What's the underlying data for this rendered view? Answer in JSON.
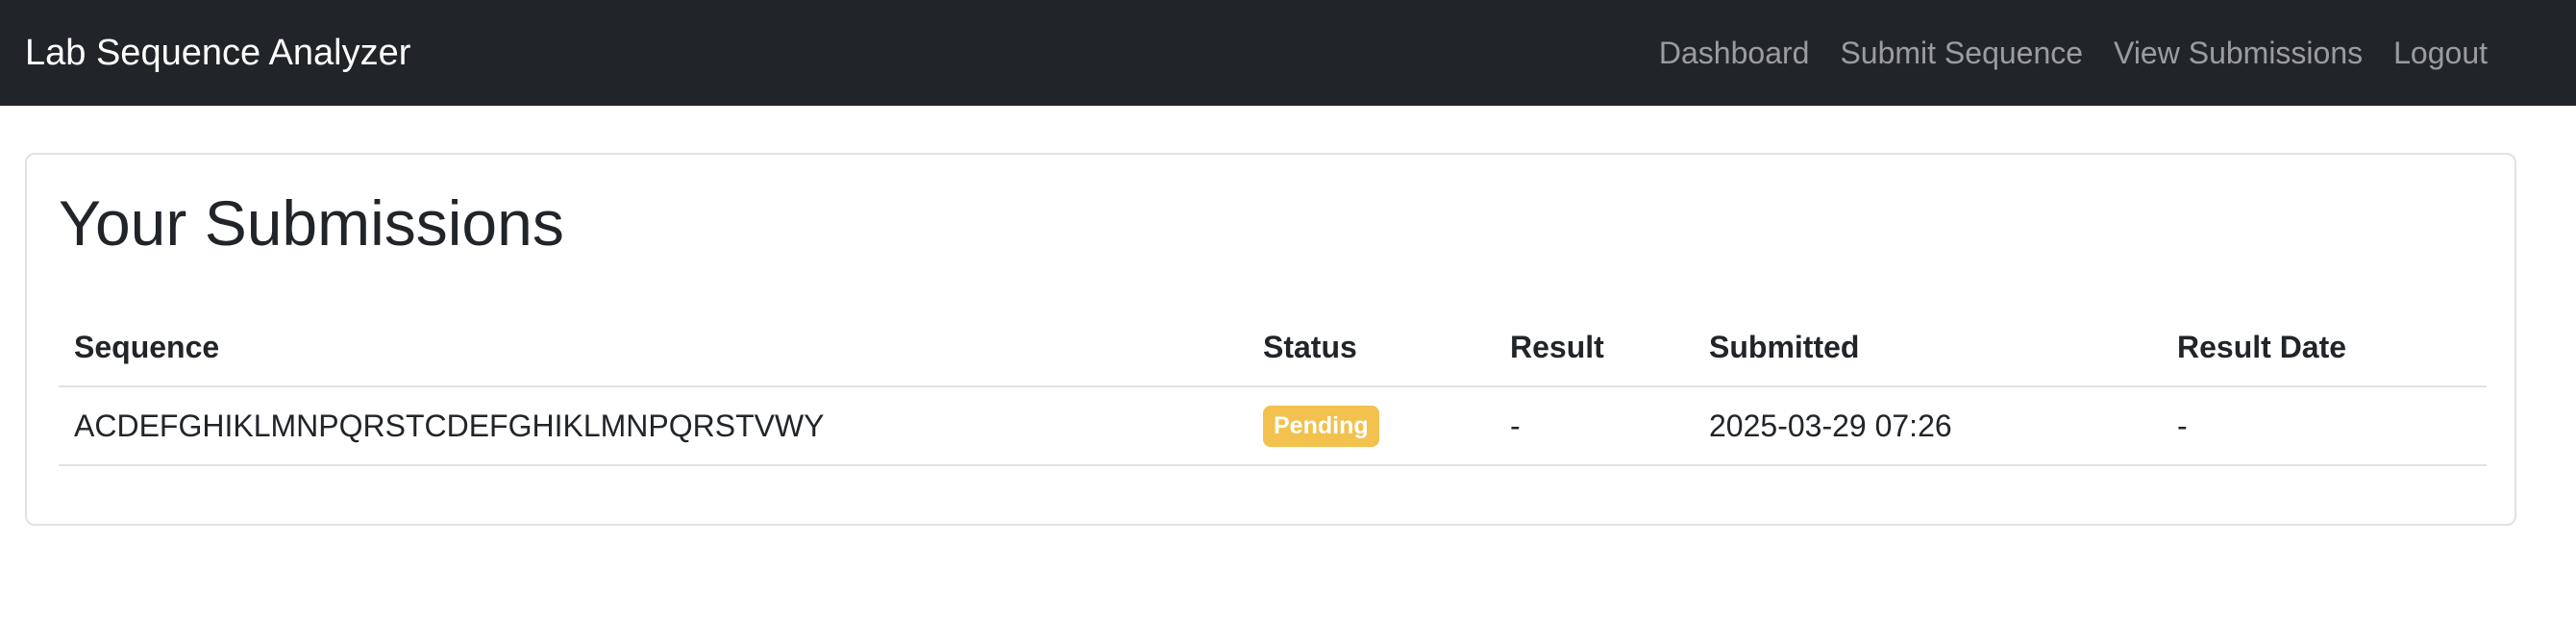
{
  "navbar": {
    "brand": "Lab Sequence Analyzer",
    "links": [
      "Dashboard",
      "Submit Sequence",
      "View Submissions",
      "Logout"
    ]
  },
  "main": {
    "title": "Your Submissions",
    "table": {
      "headers": [
        "Sequence",
        "Status",
        "Result",
        "Submitted",
        "Result Date"
      ],
      "rows": [
        {
          "sequence": "ACDEFGHIKLMNPQRSTCDEFGHIKLMNPQRSTVWY",
          "status": "Pending",
          "result": "-",
          "submitted": "2025-03-29 07:26",
          "result_date": "-"
        }
      ]
    }
  },
  "colors": {
    "navbar_bg": "#212529",
    "status_pending": "#f2c14e"
  }
}
